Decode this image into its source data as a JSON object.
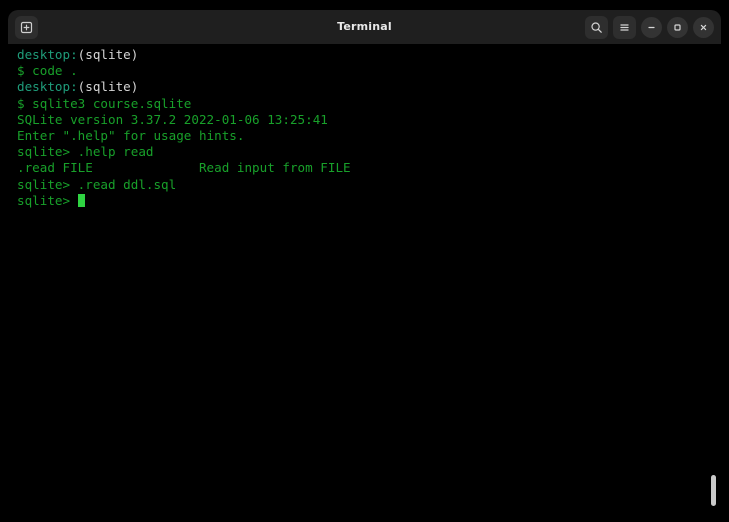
{
  "window": {
    "title": "Terminal",
    "titlebar": {
      "left_buttons": [
        {
          "name": "new-terminal-icon",
          "label": "New Terminal"
        }
      ],
      "right_buttons": [
        {
          "name": "search-icon",
          "label": "Search"
        },
        {
          "name": "hamburger-menu-icon",
          "label": "Menu"
        },
        {
          "name": "minimize-icon",
          "label": "Minimize"
        },
        {
          "name": "maximize-icon",
          "label": "Maximize"
        },
        {
          "name": "close-icon",
          "label": "Close"
        }
      ]
    }
  },
  "colors": {
    "background": "#000000",
    "titlebar": "#1f1f1f",
    "prompt_green": "#18a02a",
    "host_teal": "#1f9c7a",
    "text_white": "#d6d6d6",
    "cursor": "#2fd342",
    "scrollbar_thumb": "#c9c9c9"
  },
  "terminal": {
    "lines": [
      {
        "id": "line-1",
        "segments": [
          {
            "text": "desktop:",
            "color": "teal"
          },
          {
            "text": "(sqlite)",
            "color": "white"
          }
        ]
      },
      {
        "id": "line-2",
        "segments": [
          {
            "text": "$ code .",
            "color": "green"
          }
        ]
      },
      {
        "id": "line-3",
        "segments": [
          {
            "text": "desktop:",
            "color": "teal"
          },
          {
            "text": "(sqlite)",
            "color": "white"
          }
        ]
      },
      {
        "id": "line-4",
        "segments": [
          {
            "text": "$ sqlite3 course.sqlite",
            "color": "green"
          }
        ]
      },
      {
        "id": "line-5",
        "segments": [
          {
            "text": "SQLite version 3.37.2 2022-01-06 13:25:41",
            "color": "green"
          }
        ]
      },
      {
        "id": "line-6",
        "segments": [
          {
            "text": "Enter \".help\" for usage hints.",
            "color": "green"
          }
        ]
      },
      {
        "id": "line-7",
        "segments": [
          {
            "text": "sqlite> .help read",
            "color": "green"
          }
        ]
      },
      {
        "id": "line-8",
        "segments": [
          {
            "text": ".read FILE              Read input from FILE",
            "color": "green"
          }
        ]
      },
      {
        "id": "line-9",
        "segments": [
          {
            "text": "sqlite> .read ddl.sql",
            "color": "green"
          }
        ]
      },
      {
        "id": "line-10",
        "segments": [
          {
            "text": "sqlite> ",
            "color": "green"
          }
        ],
        "cursor": true
      }
    ]
  },
  "scrollbar": {
    "thumb_label": "vertical-scroll-thumb"
  }
}
